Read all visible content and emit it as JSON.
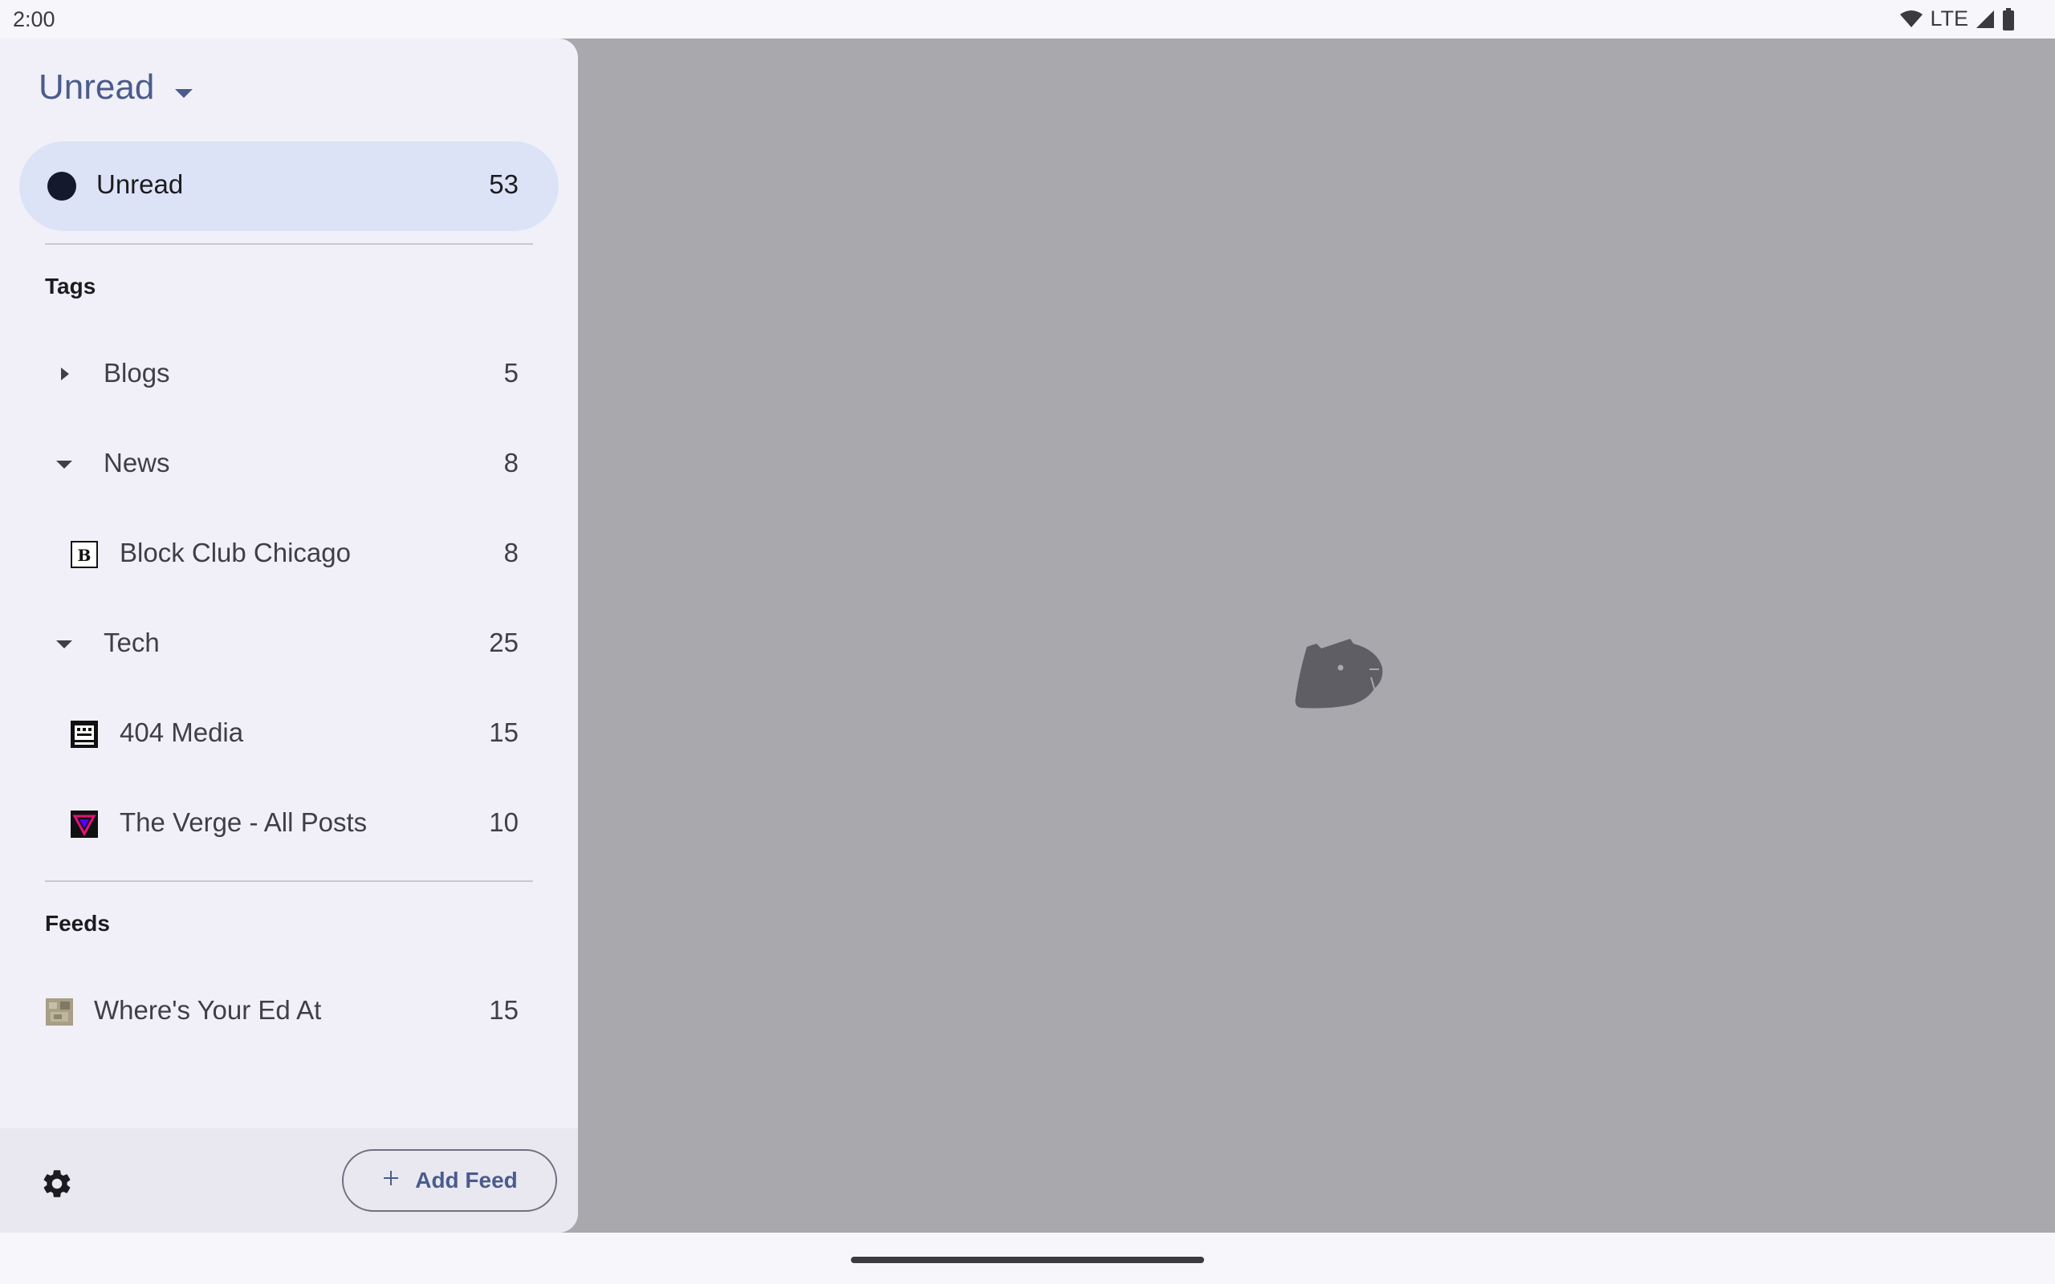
{
  "status_bar": {
    "time": "2:00",
    "network": "LTE"
  },
  "drawer": {
    "header": {
      "title": "Unread"
    },
    "unread": {
      "label": "Unread",
      "count": "53"
    },
    "tags_title": "Tags",
    "tags": [
      {
        "label": "Blogs",
        "count": "5",
        "expanded": false
      },
      {
        "label": "News",
        "count": "8",
        "expanded": true
      },
      {
        "label": "Block Club Chicago",
        "count": "8",
        "icon": "block-club-favicon"
      },
      {
        "label": "Tech",
        "count": "25",
        "expanded": true
      },
      {
        "label": "404 Media",
        "count": "15",
        "icon": "404-media-favicon"
      },
      {
        "label": "The Verge - All Posts",
        "count": "10",
        "icon": "verge-favicon"
      }
    ],
    "feeds_title": "Feeds",
    "feeds": [
      {
        "label": "Where's Your Ed At",
        "count": "15",
        "icon": "ed-at-favicon"
      }
    ],
    "footer": {
      "add_feed_label": "Add Feed"
    }
  },
  "colors": {
    "accent": "#4a5c8c",
    "selected_bg": "#dde3f7",
    "scrim": "#a9a8ad"
  }
}
